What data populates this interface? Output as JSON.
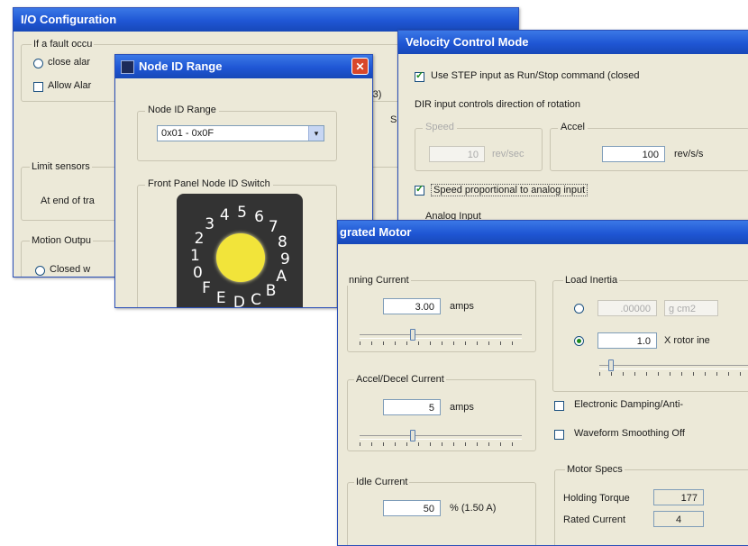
{
  "io_window": {
    "title": "I/O Configuration",
    "fault_text": "If a fault occu",
    "close_alarm": "close alar",
    "allow_alarm": "Allow Alar",
    "limit_sensors": "Limit sensors",
    "end_of_travel": "At end of tra",
    "motion_output": "Motion Outpu",
    "closed": "Closed w",
    "cut_text": "(3)",
    "cut_text2": "S"
  },
  "node_window": {
    "title": "Node ID Range",
    "close_glyph": "✕",
    "range_group": "Node ID Range",
    "range_value": "0x01 - 0x0F",
    "dropdown_glyph": "▾",
    "switch_group": "Front Panel Node ID Switch",
    "dial_digits": [
      "0",
      "1",
      "2",
      "3",
      "4",
      "5",
      "6",
      "7",
      "8",
      "9",
      "A",
      "B",
      "C",
      "D",
      "E",
      "F"
    ]
  },
  "velocity_window": {
    "title": "Velocity Control Mode",
    "use_step": "Use STEP input as Run/Stop command (closed",
    "dir_text": "DIR input controls direction of rotation",
    "speed_label": "Speed",
    "speed_value": "10",
    "speed_unit": "rev/sec",
    "accel_label": "Accel",
    "accel_value": "100",
    "accel_unit": "rev/s/s",
    "speed_proportional": "Speed proportional to analog input",
    "analog_input": "Analog Input"
  },
  "motor_window": {
    "title": "grated Motor",
    "running_current_label": "nning Current",
    "running_current_value": "3.00",
    "running_unit": "amps",
    "accel_decel_label": "Accel/Decel Current",
    "accel_decel_value": "5",
    "accel_decel_unit": "amps",
    "idle_label": "Idle Current",
    "idle_value": "50",
    "idle_unit": "% (1.50 A)",
    "load_inertia_label": "Load Inertia",
    "inertia_value1": ".00000",
    "inertia_unit1": "g cm2",
    "inertia_value2": "1.0",
    "inertia_unit2": "X rotor ine",
    "electronic_damping": "Electronic Damping/Anti-",
    "waveform_smoothing": "Waveform Smoothing Off",
    "motor_specs_label": "Motor Specs",
    "holding_torque_label": "Holding Torque",
    "holding_torque_value": "177",
    "rated_current_label": "Rated Current",
    "rated_current_value": "4"
  },
  "colors": {
    "title_bar": "#1f56d4",
    "dialog_bg": "#ece9d8",
    "dial_body": "#333333",
    "dial_knob": "#f2e43a",
    "close_button": "#d8472a"
  }
}
